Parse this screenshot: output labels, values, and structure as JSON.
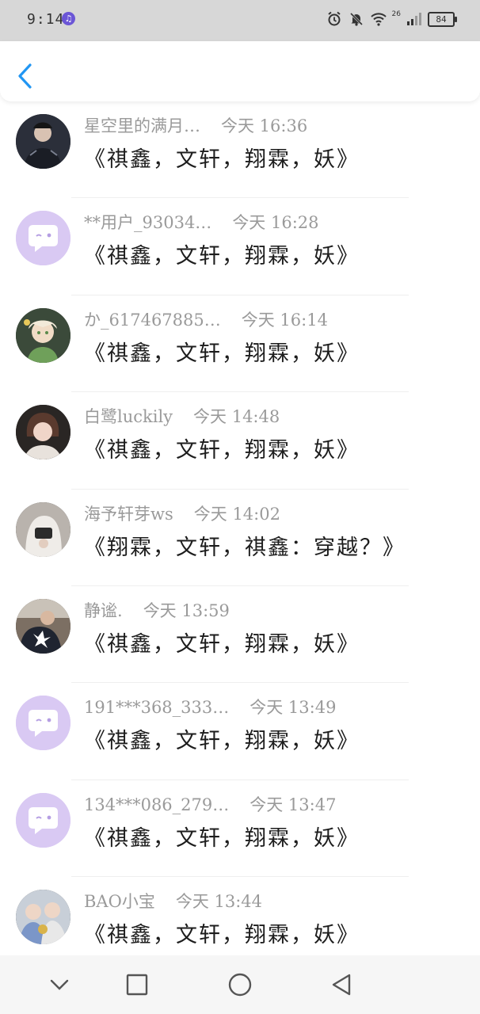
{
  "status_bar": {
    "time": "9:14",
    "app_icon": "music-note-icon",
    "network": "26",
    "battery": "84",
    "icons": [
      "alarm-icon",
      "mute-icon",
      "wifi-icon",
      "signal-icon",
      "battery-icon"
    ]
  },
  "header": {
    "back_icon": "chevron-left-icon",
    "accent_color": "#2196f3"
  },
  "comments": [
    {
      "name": "星空里的满月…",
      "time": "今天 16:36",
      "message": "《祺鑫，文轩，翔霖，妖》",
      "avatar": "photo-dark-outfit"
    },
    {
      "name": "**用户_93034…",
      "time": "今天 16:28",
      "message": "《祺鑫，文轩，翔霖，妖》",
      "avatar": "default-chat-bubble"
    },
    {
      "name": "か_617467885…",
      "time": "今天 16:14",
      "message": "《祺鑫，文轩，翔霖，妖》",
      "avatar": "photo-anime-character"
    },
    {
      "name": "白鹭luckily",
      "time": "今天 14:48",
      "message": "《祺鑫，文轩，翔霖，妖》",
      "avatar": "photo-girl-portrait"
    },
    {
      "name": "海予轩芽ws",
      "time": "今天 14:02",
      "message": "《翔霖，文轩，祺鑫：穿越？》",
      "avatar": "photo-hooded-person"
    },
    {
      "name": "静谧.",
      "time": "今天 13:59",
      "message": "《祺鑫，文轩，翔霖，妖》",
      "avatar": "photo-star-shirt"
    },
    {
      "name": "191***368_333…",
      "time": "今天 13:49",
      "message": "《祺鑫，文轩，翔霖，妖》",
      "avatar": "default-chat-bubble"
    },
    {
      "name": "134***086_279…",
      "time": "今天 13:47",
      "message": "《祺鑫，文轩，翔霖，妖》",
      "avatar": "default-chat-bubble"
    },
    {
      "name": "BAO小宝",
      "time": "今天 13:44",
      "message": "《祺鑫，文轩，翔霖，妖》",
      "avatar": "photo-group-kids"
    }
  ],
  "nav_bar": {
    "buttons": [
      "chevron-down-icon",
      "square-recent-apps-icon",
      "circle-home-icon",
      "triangle-back-icon"
    ]
  }
}
